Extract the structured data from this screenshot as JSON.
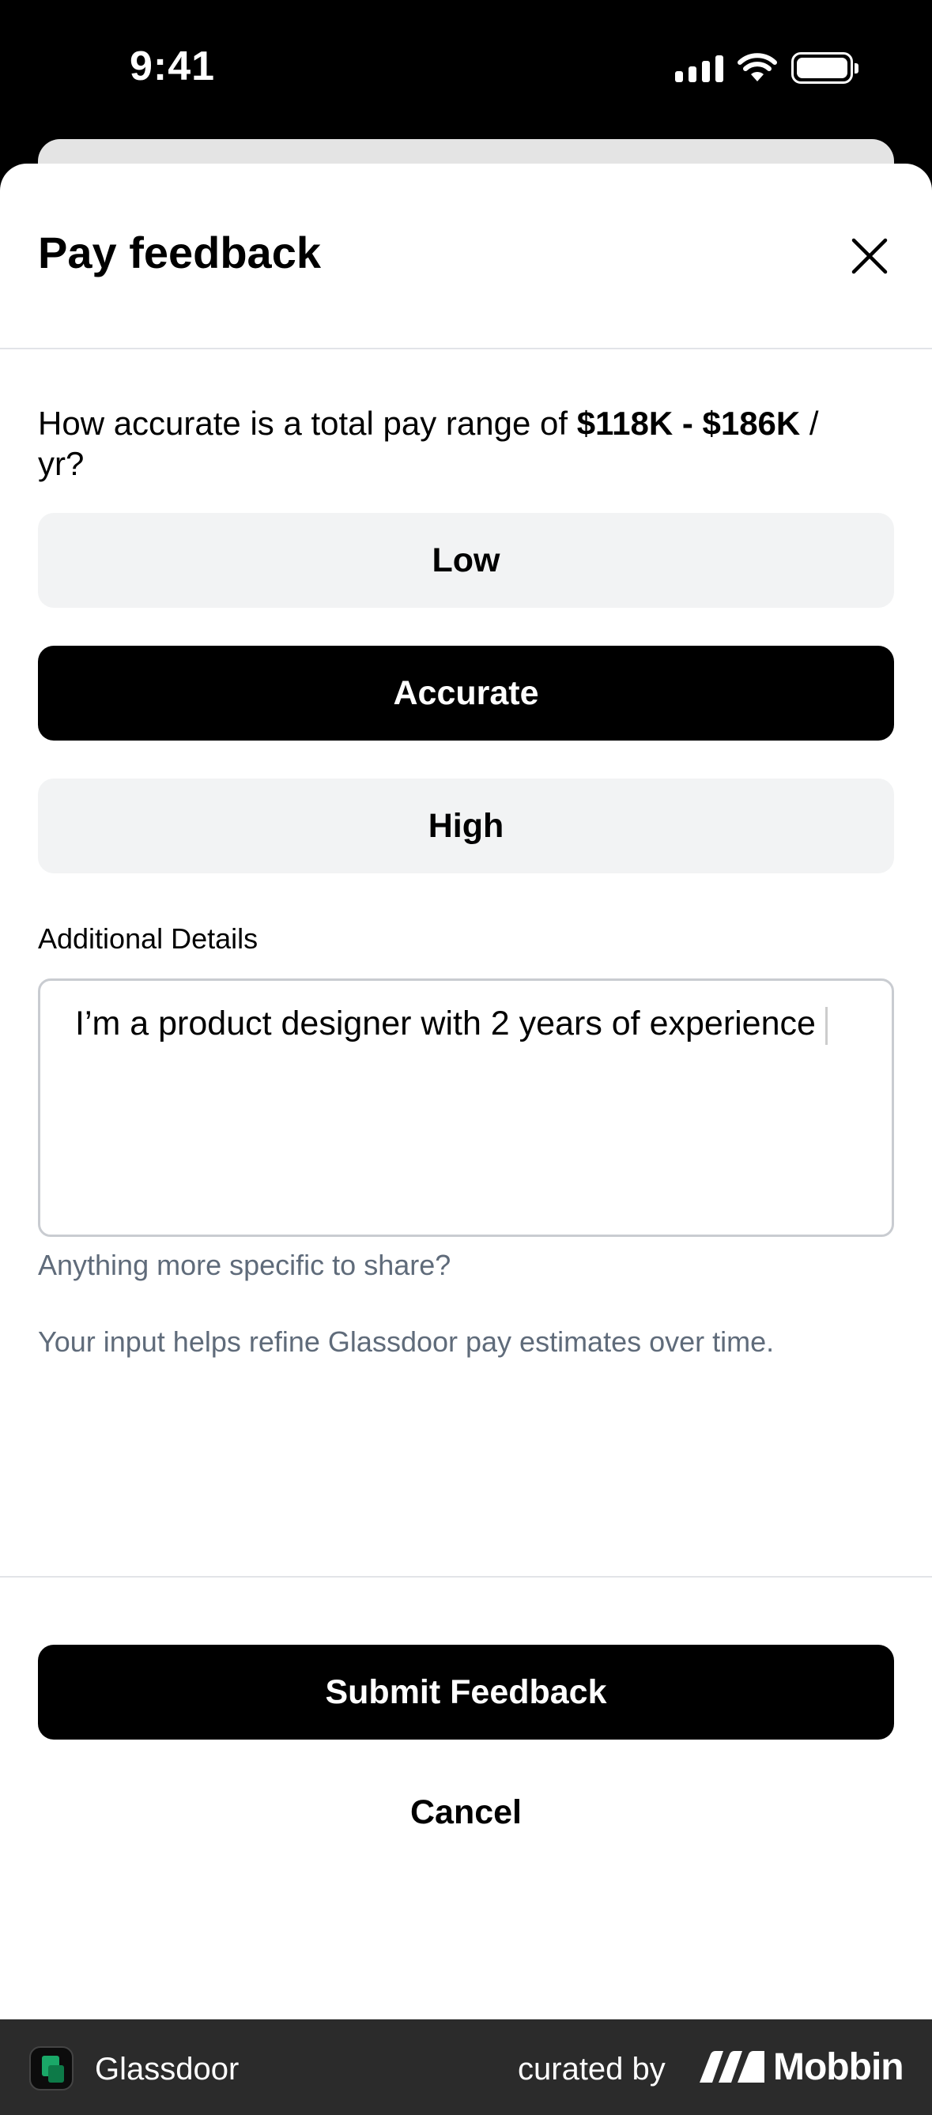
{
  "status_bar": {
    "time": "9:41"
  },
  "sheet": {
    "title": "Pay feedback",
    "question_prefix": "How accurate is a total pay range of ",
    "question_range": "$118K - $186K",
    "question_suffix": " / yr?",
    "options": [
      {
        "label": "Low",
        "selected": false
      },
      {
        "label": "Accurate",
        "selected": true
      },
      {
        "label": "High",
        "selected": false
      }
    ],
    "details_label": "Additional Details",
    "details_value": "I’m a product designer with 2 years of experience",
    "details_helper": "Anything more specific to share?",
    "note": "Your input helps refine Glassdoor pay estimates over time.",
    "submit_label": "Submit Feedback",
    "cancel_label": "Cancel"
  },
  "attribution": {
    "app_name": "Glassdoor",
    "curated_by": "curated by",
    "brand": "Mobbin"
  },
  "colors": {
    "primary": "#000000",
    "option_bg": "#f2f3f4",
    "helper_text": "#5f6b7a",
    "glassdoor_green": "#1aa868"
  }
}
